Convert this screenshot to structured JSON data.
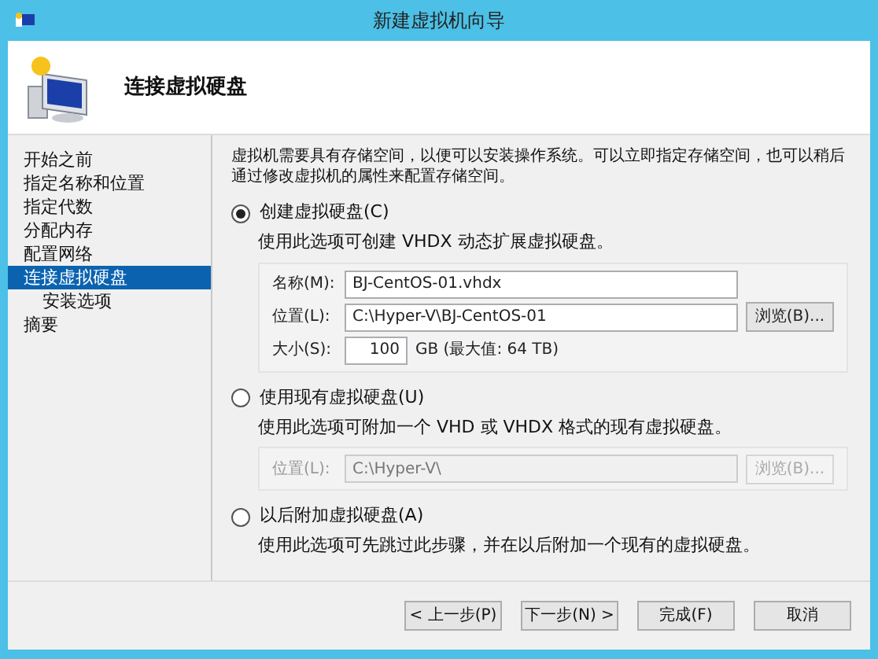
{
  "window": {
    "title": "新建虚拟机向导"
  },
  "header": {
    "title": "连接虚拟硬盘"
  },
  "sidebar": {
    "items": [
      {
        "label": "开始之前",
        "selected": false
      },
      {
        "label": "指定名称和位置",
        "selected": false
      },
      {
        "label": "指定代数",
        "selected": false
      },
      {
        "label": "分配内存",
        "selected": false
      },
      {
        "label": "配置网络",
        "selected": false
      },
      {
        "label": "连接虚拟硬盘",
        "selected": true,
        "children": [
          {
            "label": "安装选项",
            "selected": false
          }
        ]
      },
      {
        "label": "摘要",
        "selected": false
      }
    ]
  },
  "intro": "虚拟机需要具有存储空间，以便可以安装操作系统。可以立即指定存储空间，也可以稍后通过修改虚拟机的属性来配置存储空间。",
  "options": [
    {
      "label": "创建虚拟硬盘(C)",
      "selected": true,
      "description": "使用此选项可创建 VHDX 动态扩展虚拟硬盘。",
      "disabled": false,
      "fields": [
        {
          "kind": "text",
          "label": "名称(M):",
          "value": "BJ-CentOS-01.vhdx"
        },
        {
          "kind": "browse",
          "label": "位置(L):",
          "value": "C:\\Hyper-V\\BJ-CentOS-01",
          "button": "浏览(B)..."
        },
        {
          "kind": "size",
          "label": "大小(S):",
          "value": "100",
          "unit": "GB (最大值: 64 TB)"
        }
      ]
    },
    {
      "label": "使用现有虚拟硬盘(U)",
      "selected": false,
      "description": "使用此选项可附加一个 VHD 或 VHDX 格式的现有虚拟硬盘。",
      "disabled": true,
      "fields": [
        {
          "kind": "browse",
          "label": "位置(L):",
          "value": "C:\\Hyper-V\\",
          "button": "浏览(B)..."
        }
      ]
    },
    {
      "label": "以后附加虚拟硬盘(A)",
      "selected": false,
      "description": "使用此选项可先跳过此步骤，并在以后附加一个现有的虚拟硬盘。"
    }
  ],
  "buttons": [
    "< 上一步(P)",
    "下一步(N) >",
    "完成(F)",
    "取消"
  ]
}
